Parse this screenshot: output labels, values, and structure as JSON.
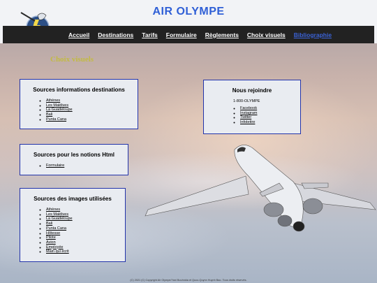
{
  "header": {
    "title": "AIR OLYMPE",
    "logo_icon": "zeus-lightning-logo-icon"
  },
  "nav": {
    "items": [
      "Accueil",
      "Destinations",
      "Tarifs",
      "Formulaire",
      "Règlements",
      "Choix visuels",
      "Bibliographie"
    ],
    "active_index": 6,
    "active_color": "#3b63d8"
  },
  "page": {
    "heading": "Choix visuels"
  },
  "panels": {
    "destinations": {
      "title": "Sources informations destinations",
      "links": [
        "Athènes",
        "Les Maldives",
        "La Guadeloupe",
        "Bali",
        "Punta Cana"
      ]
    },
    "html": {
      "title": "Sources pour les notions Html",
      "links": [
        "Formulaire"
      ]
    },
    "images": {
      "title": "Sources des images utilisées",
      "links": [
        "Athènes",
        "Les Maldives",
        "La Guadeloupe",
        "Bali",
        "Punta Cana",
        "Hôtesse",
        "Pilote",
        "Avion",
        "Employée",
        "Main qui écrit"
      ]
    },
    "join": {
      "title": "Nous rejoindre",
      "phone": "1-800-OLYMPE",
      "links": [
        "Facebook",
        "Instagram",
        "Twitter",
        "Infolettre"
      ]
    }
  },
  "footer": {
    "text": "(C) 2021 (C) Copyright Air Olympe/Yani Bouhnida et Quoc-Quynn Huynh Bao. Tous droits réservés."
  },
  "colors": {
    "title": "#2f5fd6",
    "heading": "#c2ba44",
    "panel_border": "#2233aa",
    "navbar": "#222222"
  }
}
